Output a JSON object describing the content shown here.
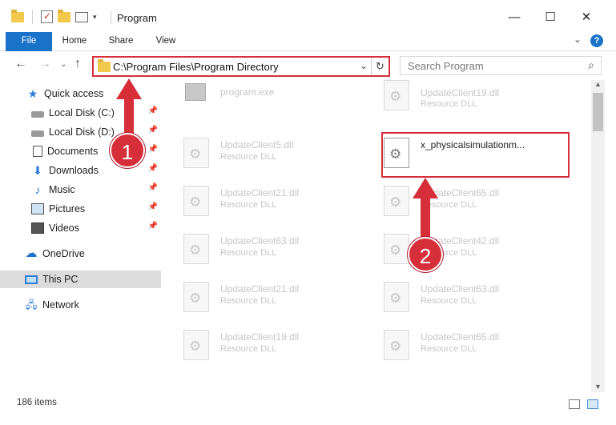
{
  "window": {
    "title": "Program"
  },
  "ribbon": {
    "tabs": [
      "File",
      "Home",
      "Share",
      "View"
    ],
    "help": "?"
  },
  "address": {
    "path": "C:\\Program Files\\Program Directory"
  },
  "search": {
    "placeholder": "Search Program"
  },
  "sidebar": {
    "items": [
      {
        "label": "Quick access"
      },
      {
        "label": "Local Disk (C:)"
      },
      {
        "label": "Local Disk (D:)"
      },
      {
        "label": "Documents"
      },
      {
        "label": "Downloads"
      },
      {
        "label": "Music"
      },
      {
        "label": "Pictures"
      },
      {
        "label": "Videos"
      },
      {
        "label": "OneDrive"
      },
      {
        "label": "This PC"
      },
      {
        "label": "Network"
      }
    ]
  },
  "files": [
    {
      "name": "program.exe",
      "type": ""
    },
    {
      "name": "UpdateClient19.dll",
      "type": "Resource DLL"
    },
    {
      "name": "UpdateClient5.dll",
      "type": "Resource DLL"
    },
    {
      "name": "x_physicalsimulationm...",
      "type": ""
    },
    {
      "name": "UpdateClient21.dll",
      "type": "Resource DLL"
    },
    {
      "name": "UpdateClient65.dll",
      "type": "Resource DLL"
    },
    {
      "name": "UpdateClient63.dll",
      "type": "Resource DLL"
    },
    {
      "name": "UpdateClient42.dll",
      "type": "Resource DLL"
    },
    {
      "name": "UpdateClient21.dll",
      "type": "Resource DLL"
    },
    {
      "name": "UpdateClient63.dll",
      "type": "Resource DLL"
    },
    {
      "name": "UpdateClient19.dll",
      "type": "Resource DLL"
    },
    {
      "name": "UpdateClient65.dll",
      "type": "Resource DLL"
    }
  ],
  "status": {
    "count": "186 items"
  },
  "callouts": [
    "1",
    "2"
  ],
  "colors": {
    "accent": "#1a73c8",
    "highlight": "#d62f3a"
  }
}
